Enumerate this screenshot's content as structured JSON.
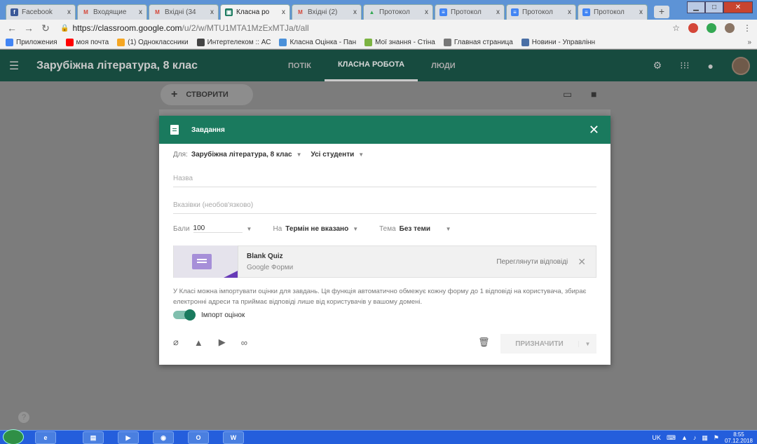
{
  "browser": {
    "tabs": [
      {
        "label": "Facebook",
        "icon": "facebook-icon",
        "color": "#3b5998",
        "glyph": "f",
        "active": false
      },
      {
        "label": "Входящие",
        "icon": "gmail-icon",
        "color": "#d44638",
        "glyph": "M",
        "active": false
      },
      {
        "label": "Вхідні (34",
        "icon": "gmail-icon",
        "color": "#d44638",
        "glyph": "M",
        "active": false
      },
      {
        "label": "Класна ро",
        "icon": "classroom-icon",
        "color": "#1a7a5e",
        "glyph": "▣",
        "active": true
      },
      {
        "label": "Вхідні (2)",
        "icon": "gmail-icon",
        "color": "#d44638",
        "glyph": "M",
        "active": false
      },
      {
        "label": "Протокол",
        "icon": "drive-icon",
        "color": "#34a853",
        "glyph": "▲",
        "active": false
      },
      {
        "label": "Протокол",
        "icon": "forms-icon",
        "color": "#4285f4",
        "glyph": "≡",
        "active": false
      },
      {
        "label": "Протокол",
        "icon": "forms-icon",
        "color": "#4285f4",
        "glyph": "≡",
        "active": false
      },
      {
        "label": "Протокол",
        "icon": "forms-icon",
        "color": "#4285f4",
        "glyph": "≡",
        "active": false
      }
    ],
    "tab_close": "x",
    "new_tab": "+",
    "url_host": "https://classroom.google.com",
    "url_path": "/u/2/w/MTU1MTA1MzExMTJa/t/all",
    "bookmarks": [
      {
        "label": "Приложения",
        "color": "#4285f4"
      },
      {
        "label": "моя почта",
        "color": "#ff0000"
      },
      {
        "label": "(1) Одноклассники",
        "color": "#f5a623"
      },
      {
        "label": "Интертелеком :: АС",
        "color": "#444444"
      },
      {
        "label": "Класна Оцінка - Пан",
        "color": "#4a90d9"
      },
      {
        "label": "Мої знання - Стіна",
        "color": "#7cb342"
      },
      {
        "label": "Главная страница",
        "color": "#777777"
      },
      {
        "label": "Новини - Управлінн",
        "color": "#4a6fa5"
      }
    ],
    "bookmarks_more": "»"
  },
  "header": {
    "class_title": "Зарубіжна література, 8 клас",
    "tabs": [
      {
        "label": "ПОТІК",
        "active": false
      },
      {
        "label": "КЛАСНА РОБОТА",
        "active": true
      },
      {
        "label": "ЛЮДИ",
        "active": false
      }
    ]
  },
  "page": {
    "create_label": "СТВОРИТИ",
    "create_plus": "+",
    "help": "?"
  },
  "dialog": {
    "title": "Завдання",
    "close": "✕",
    "for_label": "Для:",
    "class_value": "Зарубіжна література, 8 клас",
    "students_value": "Усі студенти",
    "title_placeholder": "Назва",
    "instructions_placeholder": "Вказівки (необов'язково)",
    "points_label": "Бали",
    "points_value": "100",
    "due_label": "На",
    "due_value": "Термін не вказано",
    "topic_label": "Тема",
    "topic_value": "Без теми",
    "attachment": {
      "name": "Blank Quiz",
      "type": "Google Форми",
      "view_label": "Переглянути відповіді",
      "remove": "✕"
    },
    "import_note": "У Класі можна імпортувати оцінки для завдань. Ця функція автоматично обмежує кожну форму до 1 відповіді на користувача, збирає електронні адреси та приймає відповіді лише від користувачів у вашому домені.",
    "import_toggle_label": "Імпорт оцінок",
    "import_toggle_on": true,
    "assign_label": "ПРИЗНАЧИТИ"
  },
  "taskbar": {
    "apps": [
      "ie",
      "explorer",
      "media",
      "chrome",
      "opera",
      "word"
    ],
    "lang": "UK",
    "time": "8:55",
    "date": "07.12.2018"
  },
  "colors": {
    "classroom_green": "#1a7a5e",
    "header_dark": "#174b3f",
    "overlay_gray": "#7c7c7c"
  }
}
